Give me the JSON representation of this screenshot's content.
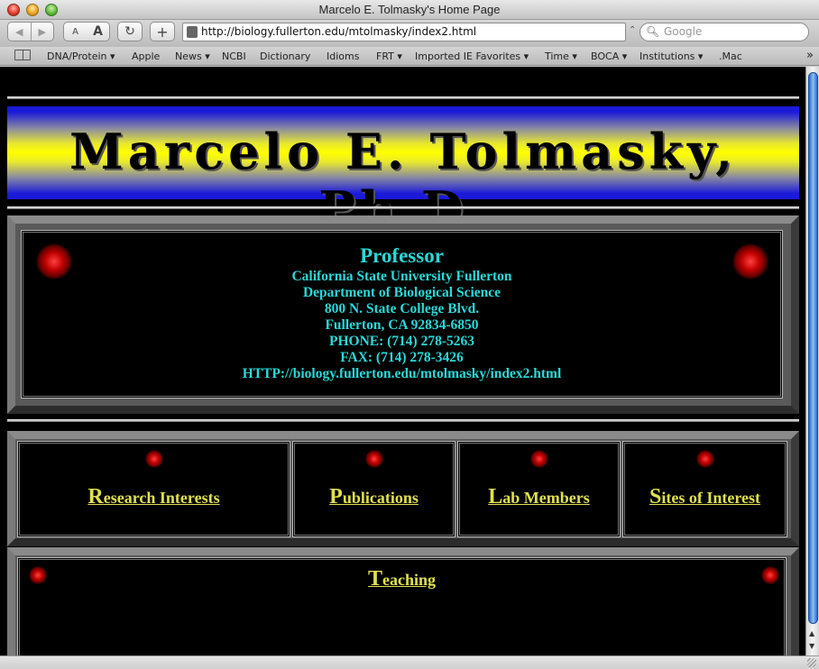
{
  "window": {
    "title": "Marcelo E. Tolmasky's Home Page"
  },
  "toolbar": {
    "back_icon": "back-arrow-icon",
    "forward_icon": "forward-arrow-icon",
    "text_smaller": "A",
    "text_bigger": "A",
    "reload_glyph": "↻",
    "add_glyph": "+",
    "url": "http://biology.fullerton.edu/mtolmasky/index2.html",
    "search_placeholder": "Google"
  },
  "bookmarks": [
    {
      "label": "DNA/Protein ▾"
    },
    {
      "label": "Apple"
    },
    {
      "label": "News ▾"
    },
    {
      "label": "NCBI"
    },
    {
      "label": "Dictionary"
    },
    {
      "label": "Idioms"
    },
    {
      "label": "FRT ▾"
    },
    {
      "label": "Imported IE Favorites ▾"
    },
    {
      "label": "Time ▾"
    },
    {
      "label": "BOCA ▾"
    },
    {
      "label": "Institutions ▾"
    },
    {
      "label": ".Mac"
    }
  ],
  "page": {
    "banner": "Marcelo E. Tolmasky, Ph.D.",
    "contact": {
      "title": "Professor",
      "university": "California State University Fullerton",
      "department": "Department of Biological Science",
      "street": "800 N. State College Blvd.",
      "city": "Fullerton, CA 92834-6850",
      "phone": "PHONE: (714) 278-5263",
      "fax": "FAX: (714) 278-3426",
      "url": "HTTP://biology.fullerton.edu/mtolmasky/index2.html"
    },
    "nav_links": [
      {
        "cap": "R",
        "rest": "esearch Interests"
      },
      {
        "cap": "P",
        "rest": "ublications"
      },
      {
        "cap": "L",
        "rest": "ab Members"
      },
      {
        "cap": "S",
        "rest": "ites of Interest"
      }
    ],
    "teaching": {
      "cap": "T",
      "rest": "eaching"
    }
  },
  "colors": {
    "contact_text": "#2ad8d8",
    "link_text": "#e0e050",
    "banner_blue": "#1a1ad8",
    "banner_yellow": "#ffff00"
  }
}
